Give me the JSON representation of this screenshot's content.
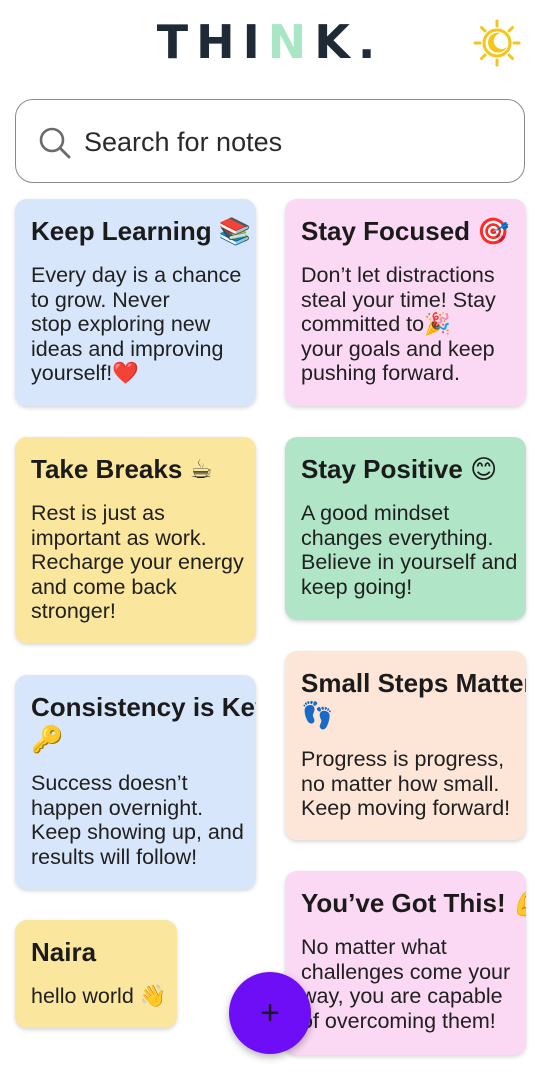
{
  "header": {
    "logo_part1": "THI",
    "logo_accent": "N",
    "logo_part2": "K.",
    "theme_toggle_icon": "sun-moon-icon"
  },
  "search": {
    "placeholder": "Search for notes",
    "icon": "search-icon"
  },
  "notes": [
    {
      "title": "Keep Learning 📚",
      "body": "Every day is a chance\nto grow. Never\nstop exploring new\nideas and improving\nyourself!❤️",
      "color": "#d7e6fb"
    },
    {
      "title": "Stay Focused 🎯",
      "body": "Don’t let distractions\nsteal your time! Stay\ncommitted to🎉\nyour goals and keep\npushing forward.",
      "color": "#fbd8f3"
    },
    {
      "title": "Take Breaks ☕",
      "body": "Rest is just as\nimportant as work.\nRecharge your energy\nand come back\nstronger!",
      "color": "#fbe69d"
    },
    {
      "title": "Stay Positive 😊",
      "body": "A good mindset\nchanges everything.\nBelieve in yourself and\nkeep going!",
      "color": "#b0e6c7"
    },
    {
      "title": "Consistency is Key 🔑",
      "body": "Success doesn’t\nhappen overnight.\nKeep showing up, and\nresults will follow!",
      "color": "#d7e6fb"
    },
    {
      "title": "Small Steps Matter 👣",
      "body": "Progress is progress,\nno matter how small.\nKeep moving forward!",
      "color": "#fde6d8"
    },
    {
      "title": "Naira",
      "body": "hello world 👋",
      "color": "#fbe69d"
    },
    {
      "title": "You’ve Got This! 💪",
      "body": "No matter what\nchallenges come your\nway, you are capable\nof overcoming them!",
      "color": "#fbd8f3"
    }
  ],
  "fab": {
    "label": "+",
    "color": "#6d0ef6"
  }
}
